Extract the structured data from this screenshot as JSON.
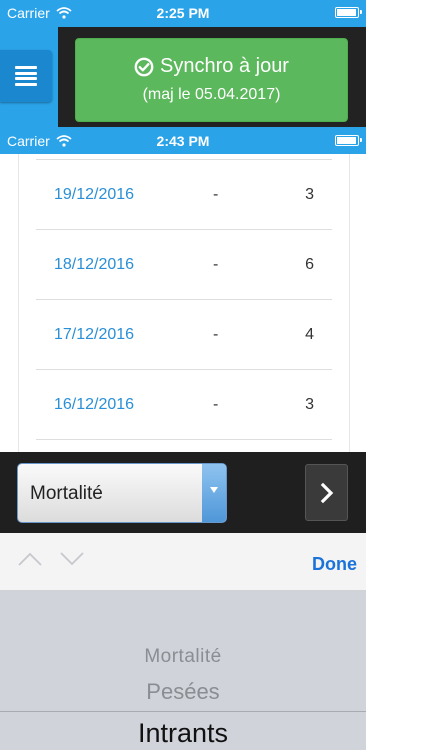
{
  "status_bar_top": {
    "carrier": "Carrier",
    "time": "2:25 PM"
  },
  "status_bar_second": {
    "carrier": "Carrier",
    "time": "2:43 PM"
  },
  "sync": {
    "title": "Synchro à jour",
    "subtitle": "(maj le 05.04.2017)"
  },
  "list": {
    "rows": [
      {
        "date": "19/12/2016",
        "dash": "-",
        "value": "3"
      },
      {
        "date": "18/12/2016",
        "dash": "-",
        "value": "6"
      },
      {
        "date": "17/12/2016",
        "dash": "-",
        "value": "4"
      },
      {
        "date": "16/12/2016",
        "dash": "-",
        "value": "3"
      }
    ]
  },
  "select": {
    "value": "Mortalité"
  },
  "picker": {
    "done_label": "Done",
    "options": [
      "Mortalité",
      "Pesées",
      "Intrants"
    ]
  },
  "colors": {
    "header_blue": "#2aa3e8",
    "sync_green": "#5cb85c",
    "link_blue": "#2a8fd6",
    "done_blue": "#1a73d9"
  },
  "icons": [
    "wifi-icon",
    "battery-icon",
    "menu-icon",
    "check-circle-icon",
    "chevron-up-icon",
    "chevron-down-icon",
    "chevron-right-icon",
    "dropdown-arrow-icon"
  ]
}
